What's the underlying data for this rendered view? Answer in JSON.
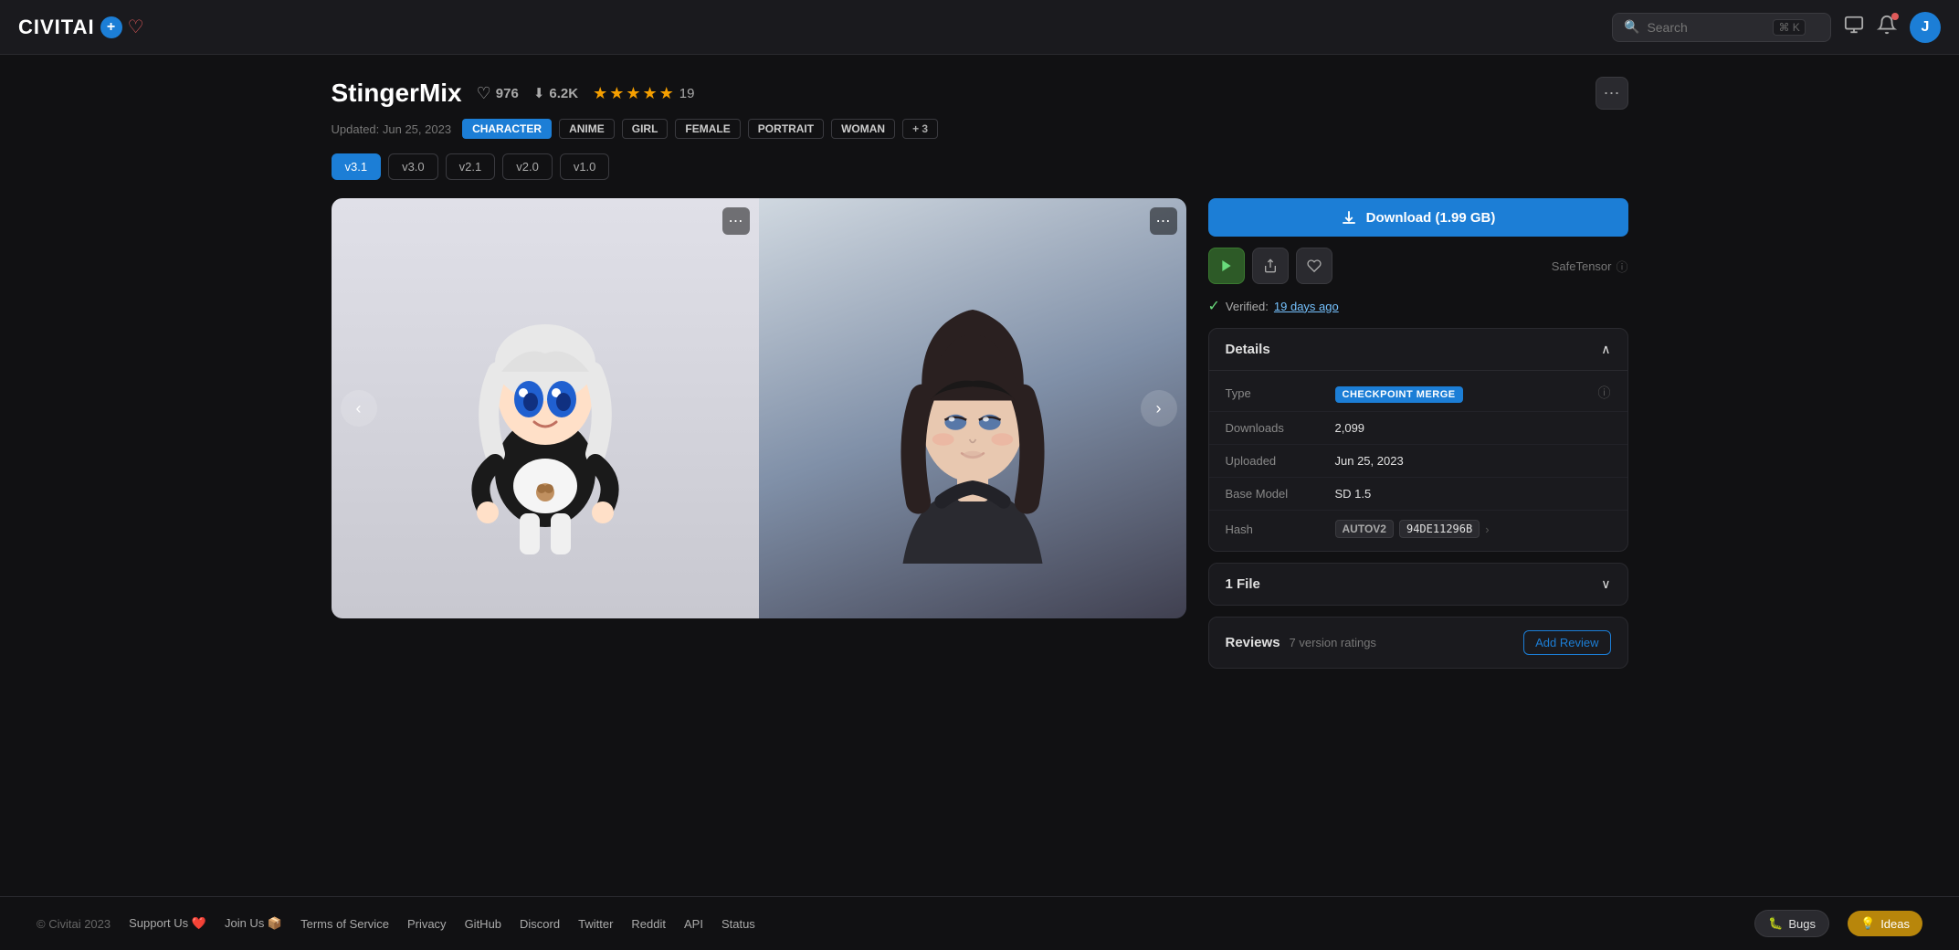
{
  "header": {
    "logo_text": "CIVIT",
    "logo_ai": "AI",
    "search_placeholder": "Search",
    "search_shortcut": "⌘ K",
    "avatar_initial": "J"
  },
  "page": {
    "title": "StingerMix",
    "like_count": "976",
    "download_count": "6.2K",
    "star_count": 5,
    "review_count": "19",
    "updated_text": "Updated: Jun 25, 2023",
    "tags": [
      "CHARACTER",
      "ANIME",
      "GIRL",
      "FEMALE",
      "PORTRAIT",
      "WOMAN",
      "+ 3"
    ],
    "versions": [
      "v3.1",
      "v3.0",
      "v2.1",
      "v2.0",
      "v1.0"
    ],
    "active_version": "v3.1"
  },
  "download_btn": {
    "label": "Download (1.99 GB)"
  },
  "details": {
    "section_title": "Details",
    "type_label": "Type",
    "type_badge": "CHECKPOINT MERGE",
    "downloads_label": "Downloads",
    "downloads_value": "2,099",
    "uploaded_label": "Uploaded",
    "uploaded_value": "Jun 25, 2023",
    "base_model_label": "Base Model",
    "base_model_value": "SD 1.5",
    "hash_label": "Hash",
    "hash_tag": "AUTOV2",
    "hash_value": "94DE11296B"
  },
  "files": {
    "section_title": "1 File"
  },
  "reviews": {
    "section_title": "Reviews",
    "subtitle": "7 version ratings",
    "add_btn": "Add Review"
  },
  "verified": {
    "text": "Verified:",
    "link": "19 days ago"
  },
  "safe_tensor": "SafeTensor",
  "footer": {
    "copyright": "© Civitai 2023",
    "links": [
      "Support Us ❤️",
      "Join Us 📦",
      "Terms of Service",
      "Privacy",
      "GitHub",
      "Discord",
      "Twitter",
      "Reddit",
      "API",
      "Status"
    ],
    "bugs_label": "🐛 Bugs",
    "ideas_label": "💡 Ideas"
  }
}
